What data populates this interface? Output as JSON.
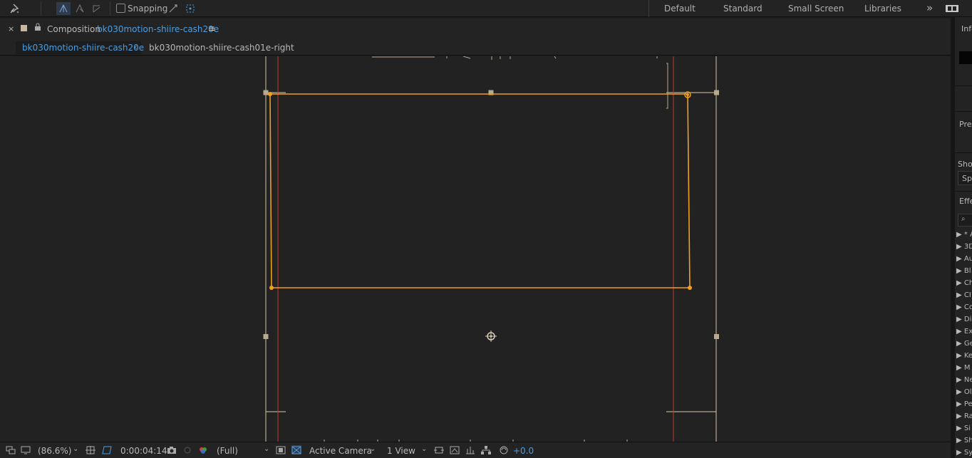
{
  "toolbar": {
    "snapping_label": "Snapping",
    "workspaces": [
      "Default",
      "Standard",
      "Small Screen",
      "Libraries"
    ],
    "overflow_glyph": "»",
    "icons": [
      "pin-tool-icon",
      "axis-local-icon",
      "axis-world-icon",
      "axis-view-icon",
      "snap-feature-icon",
      "snap-extend-icon",
      "workspace-grid-icon"
    ]
  },
  "composition_panel": {
    "close_glyph": "×",
    "title_prefix": "Composition",
    "comp_name": "bk030motion-shiire-cash20e",
    "menu_glyph": "≡",
    "swatch_color": "#c9b89a"
  },
  "flow": {
    "active": "bk030motion-shiire-cash20e",
    "chevron": "‹",
    "next": "bk030motion-shiire-cash01e-right"
  },
  "viewer": {
    "selection_color": "#f0a020",
    "guide_color": "#c0392b",
    "outline_color": "#b8ab8c"
  },
  "bottom_bar": {
    "zoom": "(86.6%)",
    "timecode": "0:00:04:14",
    "resolution": "(Full)",
    "camera": "Active Camera",
    "views": "1 View",
    "exposure": "+0.0",
    "exposure_color": "#4d9de0"
  },
  "right_panel": {
    "info_label": "Info",
    "preview_label": "Preview",
    "show_label": "Show",
    "field_value": "Sp",
    "effects_label": "Effects",
    "effects": [
      "* A",
      "3D",
      "Au",
      "Bl",
      "Ch",
      "CI",
      "Co",
      "Di",
      "Ex",
      "Ge",
      "Ke",
      "M",
      "Ne",
      "Ol",
      "Pe",
      "Ra",
      "Si",
      "Sh",
      "Sy"
    ]
  }
}
